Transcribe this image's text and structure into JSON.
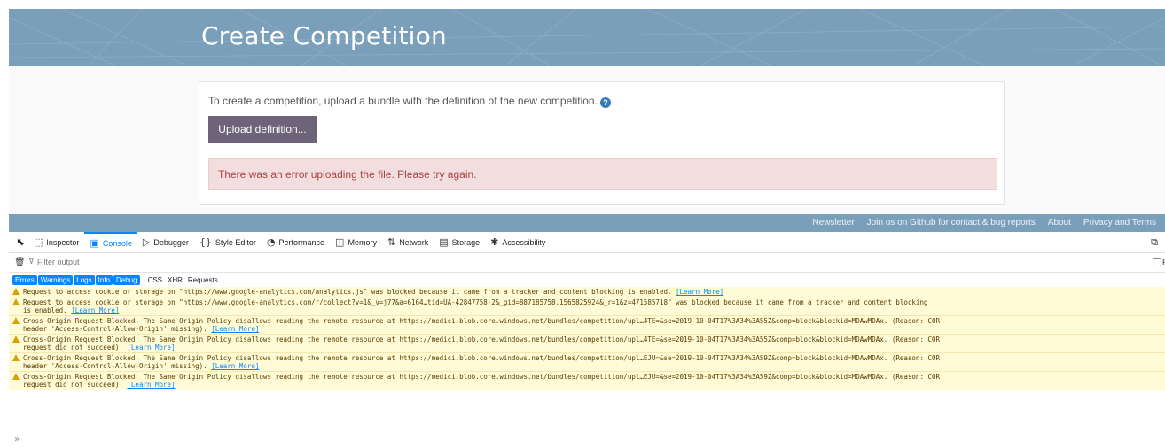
{
  "page": {
    "title": "Create Competition",
    "intro_text": "To create a competition, upload a bundle with the definition of the new competition.",
    "help_icon": "?",
    "upload_button": "Upload definition...",
    "error_message": "There was an error uploading the file. Please try again."
  },
  "footer": {
    "links": [
      "Newsletter",
      "Join us on Github for contact & bug reports",
      "About",
      "Privacy and Terms"
    ]
  },
  "devtools": {
    "tabs": [
      {
        "label": "Inspector",
        "icon": "inspector-icon",
        "glyph": "⬚"
      },
      {
        "label": "Console",
        "icon": "console-icon",
        "glyph": "▣"
      },
      {
        "label": "Debugger",
        "icon": "debugger-icon",
        "glyph": "▷"
      },
      {
        "label": "Style Editor",
        "icon": "style-editor-icon",
        "glyph": "{}"
      },
      {
        "label": "Performance",
        "icon": "performance-icon",
        "glyph": "◔"
      },
      {
        "label": "Memory",
        "icon": "memory-icon",
        "glyph": "◫"
      },
      {
        "label": "Network",
        "icon": "network-icon",
        "glyph": "⇅"
      },
      {
        "label": "Storage",
        "icon": "storage-icon",
        "glyph": "▤"
      },
      {
        "label": "Accessibility",
        "icon": "accessibility-icon",
        "glyph": "✱"
      }
    ],
    "active_tab": "Console",
    "filter_placeholder": "Filter output",
    "persist_label": "Pe",
    "categories": [
      "Errors",
      "Warnings",
      "Logs",
      "Info",
      "Debug"
    ],
    "extra_filters": [
      "CSS",
      "XHR",
      "Requests"
    ],
    "messages": [
      {
        "text": "Request to access cookie or storage on \"https://www.google-analytics.com/analytics.js\" was blocked because it came from a tracker and content blocking is enabled. ",
        "link": "[Learn More]"
      },
      {
        "text": "Request to access cookie or storage on \"https://www.google-analytics.com/r/collect?v=1&_v=j77&a=6164…tid=UA-42847758-2&_gid=887185758.1565825924&_r=1&z=471585718\" was blocked because it came from a tracker and content blocking\nis enabled. ",
        "link": "[Learn More]"
      },
      {
        "text": "Cross-Origin Request Blocked: The Same Origin Policy disallows reading the remote resource at https://medici.blob.core.windows.net/bundles/competition/upl…4TE=&se=2019-10-04T17%3A34%3A55Z&comp=block&blockid=MDAwMDAx. (Reason: COR\nheader 'Access-Control-Allow-Origin' missing). ",
        "link": "[Learn More]"
      },
      {
        "text": "Cross-Origin Request Blocked: The Same Origin Policy disallows reading the remote resource at https://medici.blob.core.windows.net/bundles/competition/upl…4TE=&se=2019-10-04T17%3A34%3A55Z&comp=block&blockid=MDAwMDAx. (Reason: COR\nrequest did not succeed). ",
        "link": "[Learn More]"
      },
      {
        "text": "Cross-Origin Request Blocked: The Same Origin Policy disallows reading the remote resource at https://medici.blob.core.windows.net/bundles/competition/upl…EJU=&se=2019-10-04T17%3A34%3A59Z&comp=block&blockid=MDAwMDAx. (Reason: COR\nheader 'Access-Control-Allow-Origin' missing). ",
        "link": "[Learn More]"
      },
      {
        "text": "Cross-Origin Request Blocked: The Same Origin Policy disallows reading the remote resource at https://medici.blob.core.windows.net/bundles/competition/upl…EJU=&se=2019-10-04T17%3A34%3A59Z&comp=block&blockid=MDAwMDAx. (Reason: COR\nrequest did not succeed). ",
        "link": "[Learn More]"
      }
    ],
    "prompt": "»",
    "colors": {
      "accent": "#0a84ff",
      "banner": "#7a9fbb",
      "warning_bg": "#fffbd6",
      "error_bg": "#f2dede",
      "button": "#6d6479"
    }
  }
}
